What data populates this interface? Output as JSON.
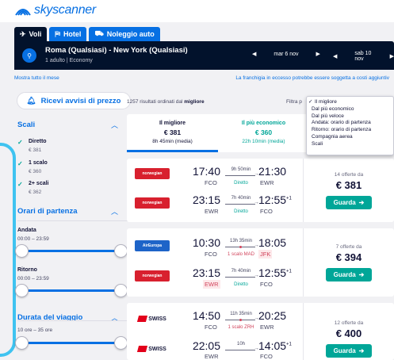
{
  "brand": {
    "name": "skyscanner"
  },
  "tabs": [
    {
      "label": "Voli",
      "icon": "plane-icon"
    },
    {
      "label": "Hotel",
      "icon": "bed-icon"
    },
    {
      "label": "Noleggio auto",
      "icon": "car-icon"
    }
  ],
  "search": {
    "route": "Roma (Qualsiasi) - New York (Qualsiasi)",
    "details": "1 adulto | Economy",
    "depart_date": "mar 6 nov",
    "return_date": "sab 10 nov"
  },
  "links": {
    "show_month": "Mostra tutto il mese",
    "baggage_note": "La franchigia in eccesso potrebbe essere soggetta a costi aggiuntiv"
  },
  "alerts": {
    "label": "Ricevi avvisi di prezzo"
  },
  "filters": {
    "stops": {
      "title": "Scali",
      "options": [
        {
          "label": "Diretto",
          "price": "€ 381"
        },
        {
          "label": "1 scalo",
          "price": "€ 360"
        },
        {
          "label": "2+ scali",
          "price": "€ 362"
        }
      ]
    },
    "departure_times": {
      "title": "Orari di partenza",
      "outbound_label": "Andata",
      "outbound_range": "00:00 – 23:59",
      "return_label": "Ritorno",
      "return_range": "00:00 – 23:59"
    },
    "duration": {
      "title": "Durata del viaggio",
      "range": "10 ore – 35 ore"
    }
  },
  "results": {
    "count_text": "1257 risultati ordinati dal",
    "count_bold": "migliore",
    "filter_by": "Filtra p"
  },
  "sort_tabs": [
    {
      "title": "Il migliore",
      "price": "€ 381",
      "duration": "8h 45min (media)"
    },
    {
      "title": "Il più economico",
      "price": "€ 360",
      "duration": "22h 10min (media)"
    }
  ],
  "sort_options": [
    "Il migliore",
    "Dal più economico",
    "Dal più veloce",
    "Andata: orario di partenza",
    "Ritorno: orario di partenza",
    "Compagnia aerea",
    "Scali"
  ],
  "flights": [
    {
      "legs": [
        {
          "airline": "norwegian",
          "dep": "17:40",
          "from": "FCO",
          "dur": "9h 50min",
          "stops": "Diretto",
          "arr": "21:30",
          "to": "EWR",
          "plus": ""
        },
        {
          "airline": "norwegian",
          "dep": "23:15",
          "from": "EWR",
          "dur": "7h 40min",
          "stops": "Diretto",
          "arr": "12:55",
          "to": "FCO",
          "plus": "+1"
        }
      ],
      "offers": "14 offerte da",
      "price": "€ 381",
      "cta": "Guarda"
    },
    {
      "legs": [
        {
          "airline": "AirEuropa",
          "dep": "10:30",
          "from": "FCO",
          "dur": "13h 35min",
          "stops": "1 scalo MAD",
          "arr": "18:05",
          "to": "JFK",
          "plus": ""
        },
        {
          "airline": "norwegian",
          "dep": "23:15",
          "from": "EWR",
          "dur": "7h 40min",
          "stops": "Diretto",
          "arr": "12:55",
          "to": "FCO",
          "plus": "+1"
        }
      ],
      "offers": "7 offerte da",
      "price": "€ 394",
      "cta": "Guarda"
    },
    {
      "legs": [
        {
          "airline": "SWISS",
          "dep": "14:50",
          "from": "FCO",
          "dur": "11h 35min",
          "stops": "1 scalo ZRH",
          "arr": "20:25",
          "to": "EWR",
          "plus": ""
        },
        {
          "airline": "SWISS",
          "dep": "22:05",
          "from": "EWR",
          "dur": "10h",
          "stops": "",
          "arr": "14:05",
          "to": "FCO",
          "plus": "+1"
        }
      ],
      "offers": "12 offerte da",
      "price": "€ 400",
      "cta": "Guarda"
    }
  ],
  "colors": {
    "brand_blue": "#0770e3",
    "navy": "#02122c",
    "teal": "#00a698",
    "alert_red": "#d1435b"
  }
}
